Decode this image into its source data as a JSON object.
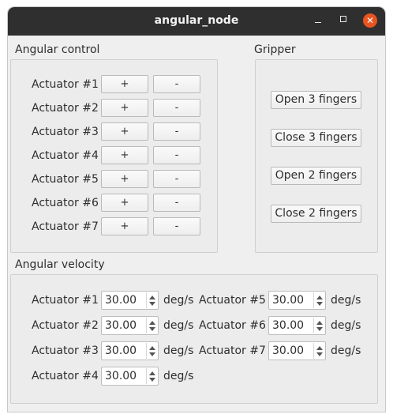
{
  "window": {
    "title": "angular_node",
    "close_glyph": "✕"
  },
  "angular_control": {
    "title": "Angular control",
    "plus_label": "+",
    "minus_label": "-",
    "actuators": [
      "Actuator #1",
      "Actuator #2",
      "Actuator #3",
      "Actuator #4",
      "Actuator #5",
      "Actuator #6",
      "Actuator #7"
    ]
  },
  "gripper": {
    "title": "Gripper",
    "buttons": [
      "Open 3 fingers",
      "Close 3 fingers",
      "Open 2 fingers",
      "Close 2 fingers"
    ]
  },
  "angular_velocity": {
    "title": "Angular velocity",
    "unit": "deg/s",
    "items": [
      {
        "label": "Actuator #1",
        "value": "30.00"
      },
      {
        "label": "Actuator #2",
        "value": "30.00"
      },
      {
        "label": "Actuator #3",
        "value": "30.00"
      },
      {
        "label": "Actuator #4",
        "value": "30.00"
      },
      {
        "label": "Actuator #5",
        "value": "30.00"
      },
      {
        "label": "Actuator #6",
        "value": "30.00"
      },
      {
        "label": "Actuator #7",
        "value": "30.00"
      }
    ]
  }
}
